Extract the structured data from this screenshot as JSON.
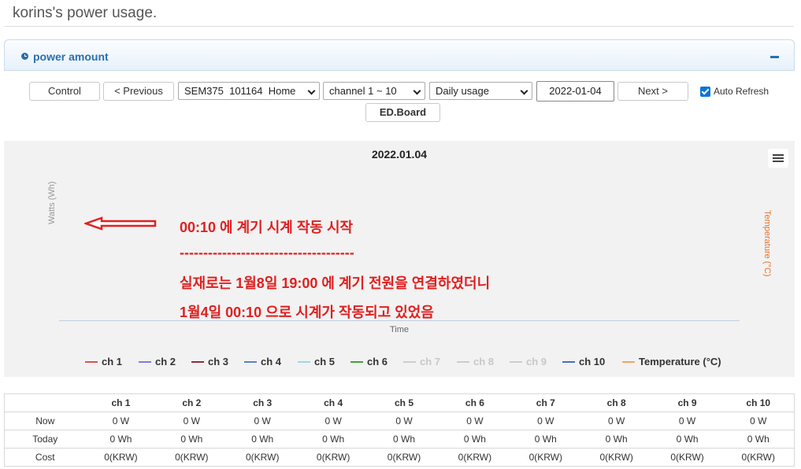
{
  "page": {
    "title": "korins's power usage."
  },
  "panel": {
    "title": "power amount"
  },
  "toolbar": {
    "control_label": "Control",
    "previous_label": "< Previous",
    "device_select": "SEM375  101164  Home",
    "channel_select": "channel 1 ~ 10",
    "period_select": "Daily usage",
    "date_value": "2022-01-04",
    "next_label": "Next >",
    "auto_refresh_label": "Auto Refresh",
    "auto_refresh_checked": true,
    "edboard_label": "ED.Board"
  },
  "chart_data": {
    "type": "line",
    "title": "2022.01.04",
    "xlabel": "Time",
    "ylabel": "Watts (Wh)",
    "ylabel_right": "Temperature (°C)",
    "series": [
      {
        "name": "ch 1",
        "color": "#d9534f",
        "visible": true,
        "values": []
      },
      {
        "name": "ch 2",
        "color": "#7b7be6",
        "visible": true,
        "values": []
      },
      {
        "name": "ch 3",
        "color": "#8b2e3a",
        "visible": true,
        "values": []
      },
      {
        "name": "ch 4",
        "color": "#5b7fc9",
        "visible": true,
        "values": []
      },
      {
        "name": "ch 5",
        "color": "#9fd8e8",
        "visible": true,
        "values": []
      },
      {
        "name": "ch 6",
        "color": "#3fa52e",
        "visible": true,
        "values": []
      },
      {
        "name": "ch 7",
        "color": "#cccccc",
        "visible": false,
        "values": []
      },
      {
        "name": "ch 8",
        "color": "#cccccc",
        "visible": false,
        "values": []
      },
      {
        "name": "ch 9",
        "color": "#cccccc",
        "visible": false,
        "values": []
      },
      {
        "name": "ch 10",
        "color": "#4a70b8",
        "visible": true,
        "values": []
      },
      {
        "name": "Temperature (°C)",
        "color": "#f4a460",
        "visible": true,
        "values": []
      }
    ],
    "legend_position": "bottom",
    "annotations": [
      "00:10 에 계기 시계 작동 시작",
      "-------------------------------------",
      "실재로는 1월8일 19:00 에 계기 전원을 연결하였더니",
      "1월4일  00:10 으로 시계가 작동되고 있었음"
    ]
  },
  "table": {
    "columns": [
      "ch 1",
      "ch 2",
      "ch 3",
      "ch 4",
      "ch 5",
      "ch 6",
      "ch 7",
      "ch 8",
      "ch 9",
      "ch 10"
    ],
    "rows": [
      {
        "label": "Now",
        "cells": [
          "0 W",
          "0 W",
          "0 W",
          "0 W",
          "0 W",
          "0 W",
          "0 W",
          "0 W",
          "0 W",
          "0 W"
        ]
      },
      {
        "label": "Today",
        "cells": [
          "0 Wh",
          "0 Wh",
          "0 Wh",
          "0 Wh",
          "0 Wh",
          "0 Wh",
          "0 Wh",
          "0 Wh",
          "0 Wh",
          "0 Wh"
        ]
      },
      {
        "label": "Cost",
        "cells": [
          "0(KRW)",
          "0(KRW)",
          "0(KRW)",
          "0(KRW)",
          "0(KRW)",
          "0(KRW)",
          "0(KRW)",
          "0(KRW)",
          "0(KRW)",
          "0(KRW)"
        ]
      }
    ]
  }
}
